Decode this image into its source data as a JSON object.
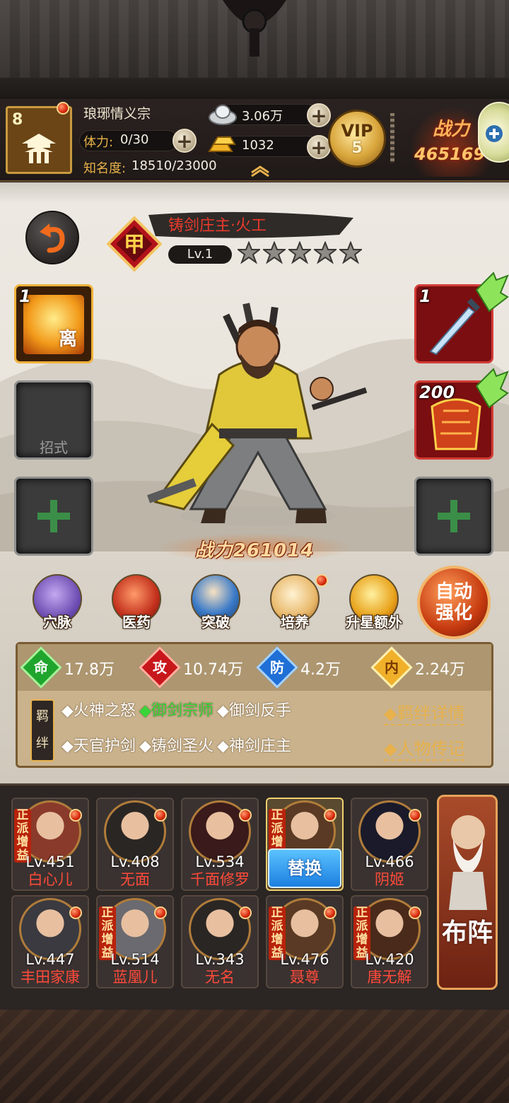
{
  "header": {
    "level": "8",
    "sect_name": "琅琊情义宗",
    "stamina_label": "体力:",
    "stamina_value": "0/30",
    "fame_label": "知名度:",
    "fame_value": "18510/23000",
    "silver": "3.06万",
    "gold": "1032",
    "vip_text": "VIP",
    "vip_level": "5",
    "battle_label": "战力",
    "battle_value": "465169"
  },
  "hero": {
    "rank": "甲",
    "name": "铸剑庄主·火工",
    "level": "Lv.1",
    "stars": 5,
    "power_label": "战力",
    "power_value": "261014"
  },
  "slots": {
    "skill_label": "招式",
    "item1_count": "1",
    "weapon_count": "1",
    "armor_count": "200"
  },
  "menu": [
    {
      "label": "穴脉"
    },
    {
      "label": "医药"
    },
    {
      "label": "突破"
    },
    {
      "label": "培养"
    },
    {
      "label": "升星额外"
    }
  ],
  "auto_strengthen": [
    "自动",
    "强化"
  ],
  "stats": [
    {
      "icon": "命",
      "value": "17.8万",
      "color": "#1fa52d"
    },
    {
      "icon": "攻",
      "value": "10.74万",
      "color": "#c8171b"
    },
    {
      "icon": "防",
      "value": "4.2万",
      "color": "#1f6fd6"
    },
    {
      "icon": "内",
      "value": "2.24万",
      "color": "#d88c12"
    }
  ],
  "bonds": {
    "tag": "羁绊",
    "row1": [
      "◆火神之怒",
      "◆御剑宗师",
      "◆御剑反手"
    ],
    "row2": [
      "◆天官护剑",
      "◆铸剑圣火",
      "◆神剑庄主"
    ],
    "link1": "◆羁绊详情",
    "link2": "◆人物传记"
  },
  "roster": {
    "badge": "正派增益",
    "swap_label": "替换",
    "formation_label": "布阵",
    "row1": [
      {
        "lv": "Lv.451",
        "name": "白心儿",
        "badge": true
      },
      {
        "lv": "Lv.408",
        "name": "无面",
        "badge": false
      },
      {
        "lv": "Lv.534",
        "name": "千面修罗",
        "badge": false
      },
      {
        "lv": "",
        "name": "",
        "badge": true,
        "selected": true
      },
      {
        "lv": "Lv.466",
        "name": "阴姬",
        "badge": false
      }
    ],
    "row2": [
      {
        "lv": "Lv.447",
        "name": "丰田家康",
        "badge": false
      },
      {
        "lv": "Lv.514",
        "name": "蓝凰儿",
        "badge": true
      },
      {
        "lv": "Lv.343",
        "name": "无名",
        "badge": false
      },
      {
        "lv": "Lv.476",
        "name": "聂尊",
        "badge": true
      },
      {
        "lv": "Lv.420",
        "name": "唐无解",
        "badge": true
      }
    ]
  }
}
